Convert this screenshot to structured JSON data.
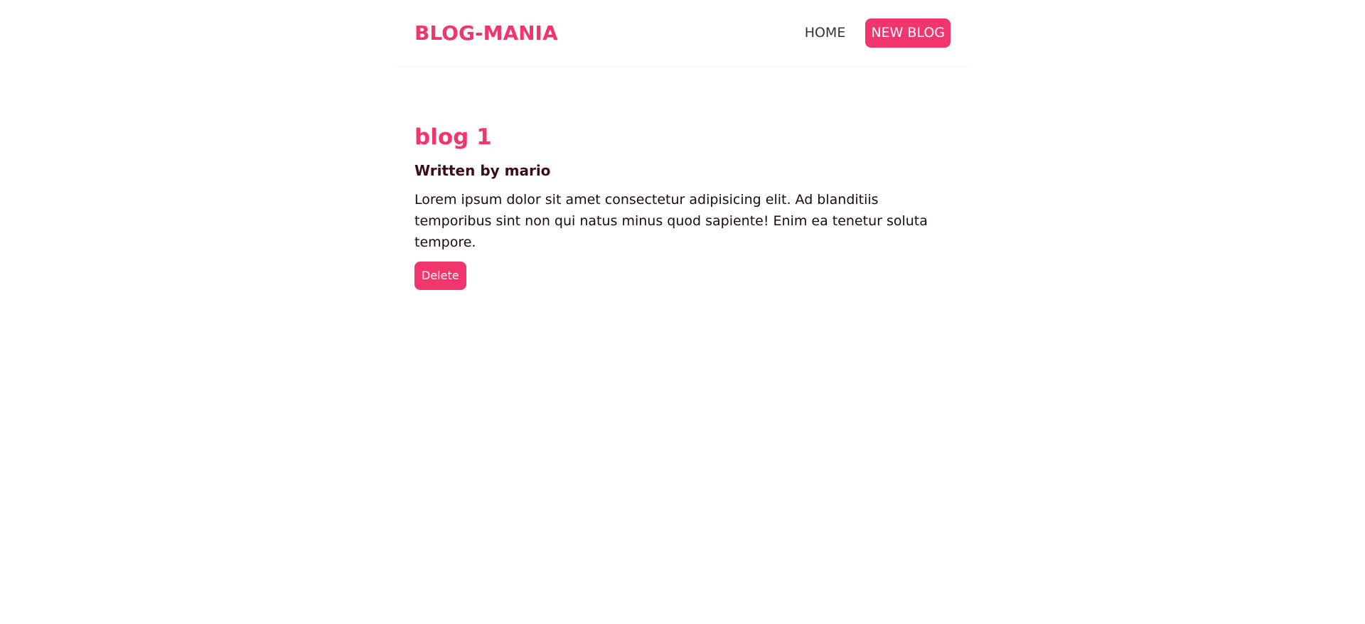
{
  "navbar": {
    "brand": "BLOG-MANIA",
    "links": [
      {
        "label": "HOME"
      },
      {
        "label": "NEW BLOG"
      }
    ]
  },
  "blog": {
    "title": "blog 1",
    "author_line": "Written by mario",
    "body": "Lorem ipsum dolor sit amet consectetur adipisicing elit. Ad blanditiis temporibus sint non qui natus minus quod sapiente! Enim ea tenetur soluta tempore.",
    "delete_label": "Delete"
  },
  "colors": {
    "accent": "#f1356d",
    "author_text": "#3a0d1c",
    "body_text": "#1b0a0f"
  }
}
